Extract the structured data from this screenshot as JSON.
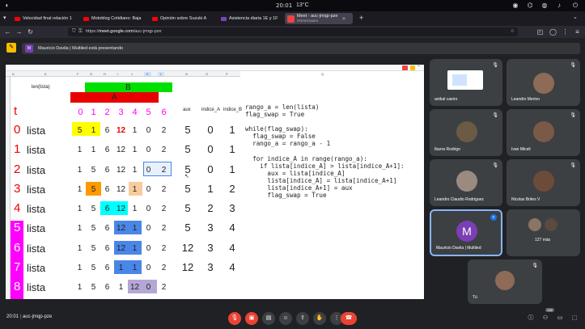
{
  "os": {
    "clock": "20:01",
    "weather": "13°C"
  },
  "tabs": [
    {
      "label": "Velocidad final relación 1",
      "favicon": "youtube-icon"
    },
    {
      "label": "Motoblog Cotidiano: Baja",
      "favicon": "youtube-icon"
    },
    {
      "label": "Opinión sobre Suzuki A",
      "favicon": "youtube-icon"
    },
    {
      "label": "Asistencia diaria 1E y 1F",
      "favicon": "forms-icon"
    },
    {
      "label": "Meet - auc-jmqp-pze",
      "sub": "PRESENTANDO",
      "favicon": "meet-icon",
      "active": true
    }
  ],
  "url": {
    "prefix": "https://",
    "host": "meet.google.com",
    "path": "/auc-jmqp-pze"
  },
  "presenting_banner": {
    "avatar": "M",
    "text": "Mauricio Davila | Multiled está presentando"
  },
  "sheet": {
    "headers": {
      "len": "len(lista)",
      "b": "B",
      "a": "A",
      "t": "t",
      "aux": "aux",
      "indice_a": "indice_A",
      "indice_b": "indice_B"
    },
    "columns": [
      "0",
      "1",
      "2",
      "3",
      "4",
      "5",
      "6"
    ],
    "rows": [
      {
        "idx": "0",
        "label": "lista",
        "vals": [
          "5",
          "1",
          "6",
          "12",
          "1",
          "0",
          "2"
        ],
        "aux": "5",
        "ia": "0",
        "ib": "1"
      },
      {
        "idx": "1",
        "label": "lista",
        "vals": [
          "1",
          "1",
          "6",
          "12",
          "1",
          "0",
          "2"
        ],
        "aux": "5",
        "ia": "0",
        "ib": "1"
      },
      {
        "idx": "2",
        "label": "lista",
        "vals": [
          "1",
          "5",
          "6",
          "12",
          "1",
          "0",
          "2"
        ],
        "aux": "5",
        "ia": "0",
        "ib": "1"
      },
      {
        "idx": "3",
        "label": "lista",
        "vals": [
          "1",
          "5",
          "6",
          "12",
          "1",
          "0",
          "2"
        ],
        "aux": "5",
        "ia": "1",
        "ib": "2"
      },
      {
        "idx": "4",
        "label": "lista",
        "vals": [
          "1",
          "5",
          "6",
          "12",
          "1",
          "0",
          "2"
        ],
        "aux": "5",
        "ia": "2",
        "ib": "3"
      },
      {
        "idx": "5",
        "label": "lista",
        "vals": [
          "1",
          "5",
          "6",
          "12",
          "1",
          "0",
          "2"
        ],
        "aux": "5",
        "ia": "3",
        "ib": "4"
      },
      {
        "idx": "6",
        "label": "lista",
        "vals": [
          "1",
          "5",
          "6",
          "12",
          "1",
          "0",
          "2"
        ],
        "aux": "12",
        "ia": "3",
        "ib": "4"
      },
      {
        "idx": "7",
        "label": "lista",
        "vals": [
          "1",
          "5",
          "6",
          "1",
          "1",
          "0",
          "2"
        ],
        "aux": "12",
        "ia": "3",
        "ib": "4"
      },
      {
        "idx": "8",
        "label": "lista",
        "vals": [
          "1",
          "5",
          "6",
          "1",
          "12",
          "0",
          "2"
        ],
        "aux": "",
        "ia": "",
        "ib": ""
      }
    ],
    "code": "rango_a = len(lista)\nflag_swap = True\n\nwhile(flag_swap):\n  flag_swap = False\n  rango_a = rango_a - 1\n\n  for indice_A in range(rango_a):\n    if lista[indice_A] > lista[indice_A+1]:\n      aux = lista[indice_A]\n      lista[indice_A] = lista[indice_A+1]\n      lista[indice_A+1] = aux\n      flag_swap = True"
  },
  "participants": [
    {
      "name": "anibal caeiro"
    },
    {
      "name": "Leandro Merino"
    },
    {
      "name": "Ibarra Rodrigo"
    },
    {
      "name": "Ivan Miceli"
    },
    {
      "name": "Leandro Claudio Rodriguez"
    },
    {
      "name": "Nicolas Brites V"
    },
    {
      "name": "Mauricio Davila | Multiled",
      "avatar": "M"
    },
    {
      "name": "127 más"
    },
    {
      "name": "Tú"
    }
  ],
  "bottom": {
    "time": "20:01",
    "code": "auc-jmqp-pze",
    "badge": "136"
  }
}
